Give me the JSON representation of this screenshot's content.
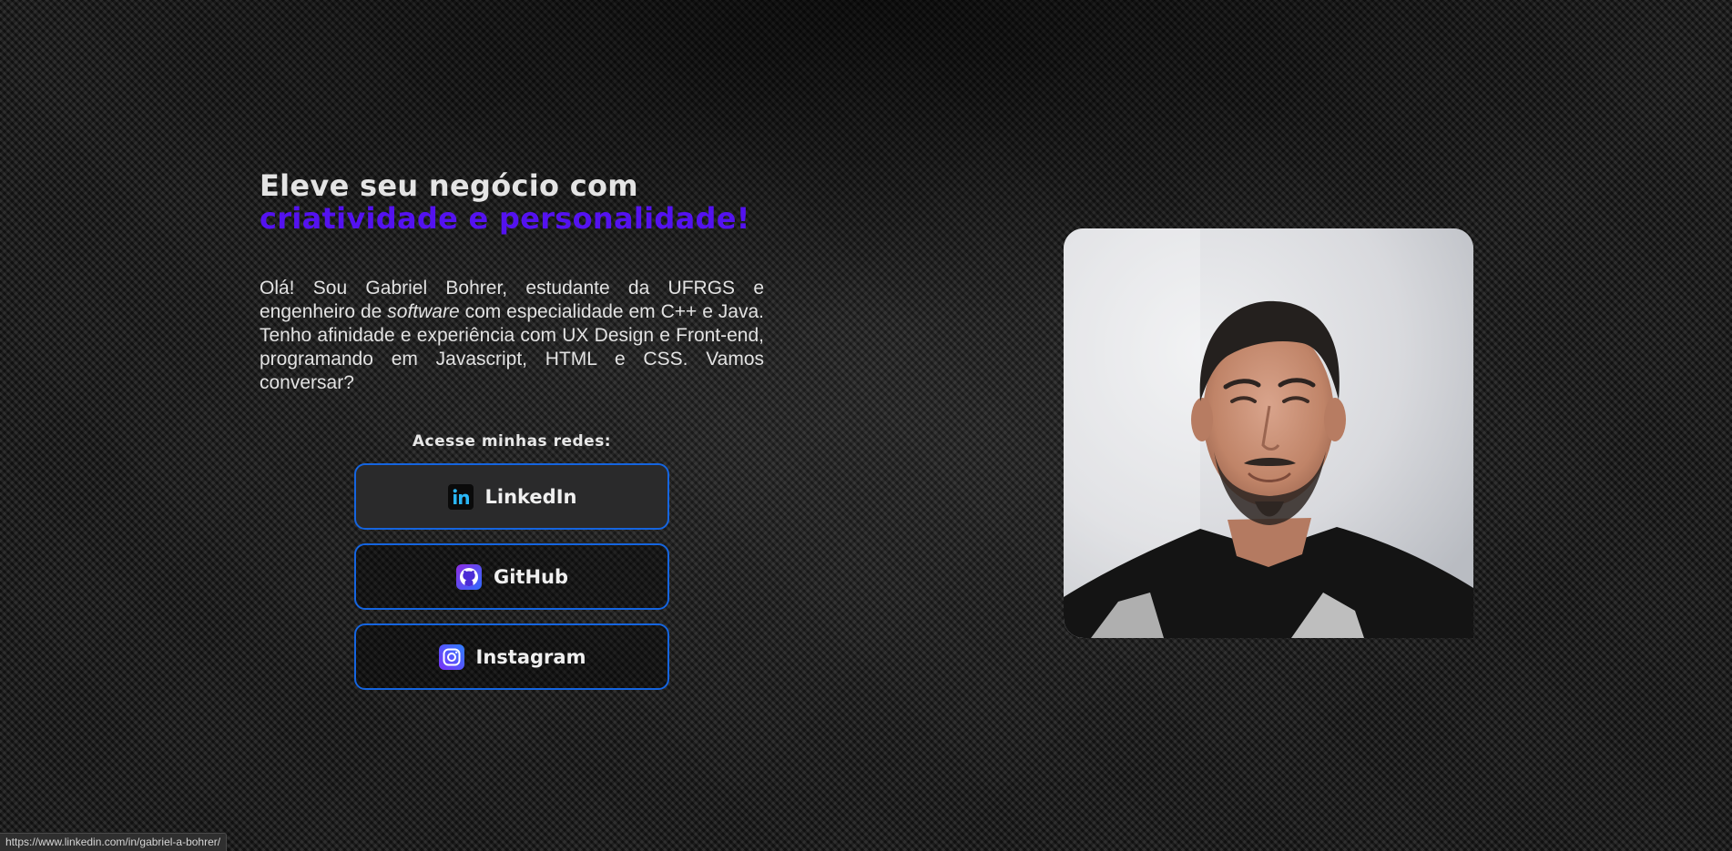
{
  "hero": {
    "headline_line1": "Eleve seu negócio com",
    "headline_line2": "criatividade e personalidade!",
    "intro_before": "Olá! Sou Gabriel Bohrer, estudante da UFRGS e engenheiro de ",
    "intro_italic": "software",
    "intro_after": " com especialidade em C++ e Java. Tenho afinidade e experiência com UX Design e Front-end, programando em Javascript, HTML e CSS. Vamos conversar?"
  },
  "socials": {
    "title": "Acesse minhas redes:",
    "links": [
      {
        "label": "LinkedIn",
        "icon": "linkedin-icon"
      },
      {
        "label": "GitHub",
        "icon": "github-icon"
      },
      {
        "label": "Instagram",
        "icon": "instagram-icon"
      }
    ]
  },
  "status_bar": {
    "url": "https://www.linkedin.com/in/gabriel-a-bohrer/"
  },
  "colors": {
    "accent_purple": "#5412f0",
    "button_border": "#1565e0",
    "background": "#1b1b1b"
  }
}
